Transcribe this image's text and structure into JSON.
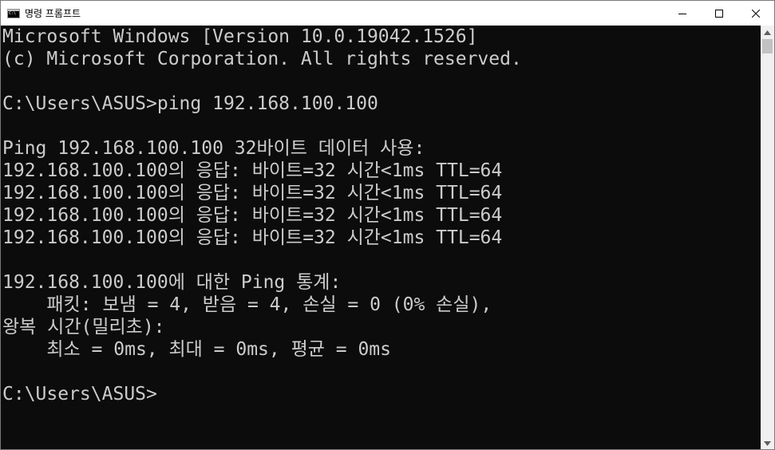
{
  "window": {
    "title": "명령 프롬프트",
    "icon": "cmd-icon",
    "controls": {
      "minimize_icon": "minimize-icon",
      "maximize_icon": "maximize-icon",
      "close_icon": "close-icon"
    }
  },
  "console": {
    "text_color": "#cccccc",
    "background": "#0c0c0c",
    "lines": [
      "Microsoft Windows [Version 10.0.19042.1526]",
      "(c) Microsoft Corporation. All rights reserved.",
      "",
      "C:\\Users\\ASUS>ping 192.168.100.100",
      "",
      "Ping 192.168.100.100 32바이트 데이터 사용:",
      "192.168.100.100의 응답: 바이트=32 시간<1ms TTL=64",
      "192.168.100.100의 응답: 바이트=32 시간<1ms TTL=64",
      "192.168.100.100의 응답: 바이트=32 시간<1ms TTL=64",
      "192.168.100.100의 응답: 바이트=32 시간<1ms TTL=64",
      "",
      "192.168.100.100에 대한 Ping 통계:",
      "    패킷: 보냄 = 4, 받음 = 4, 손실 = 0 (0% 손실),",
      "왕복 시간(밀리초):",
      "    최소 = 0ms, 최대 = 0ms, 평균 = 0ms",
      "",
      "C:\\Users\\ASUS>"
    ]
  },
  "scrollbar": {
    "up_icon": "scroll-up-arrow-icon",
    "down_icon": "scroll-down-arrow-icon"
  }
}
